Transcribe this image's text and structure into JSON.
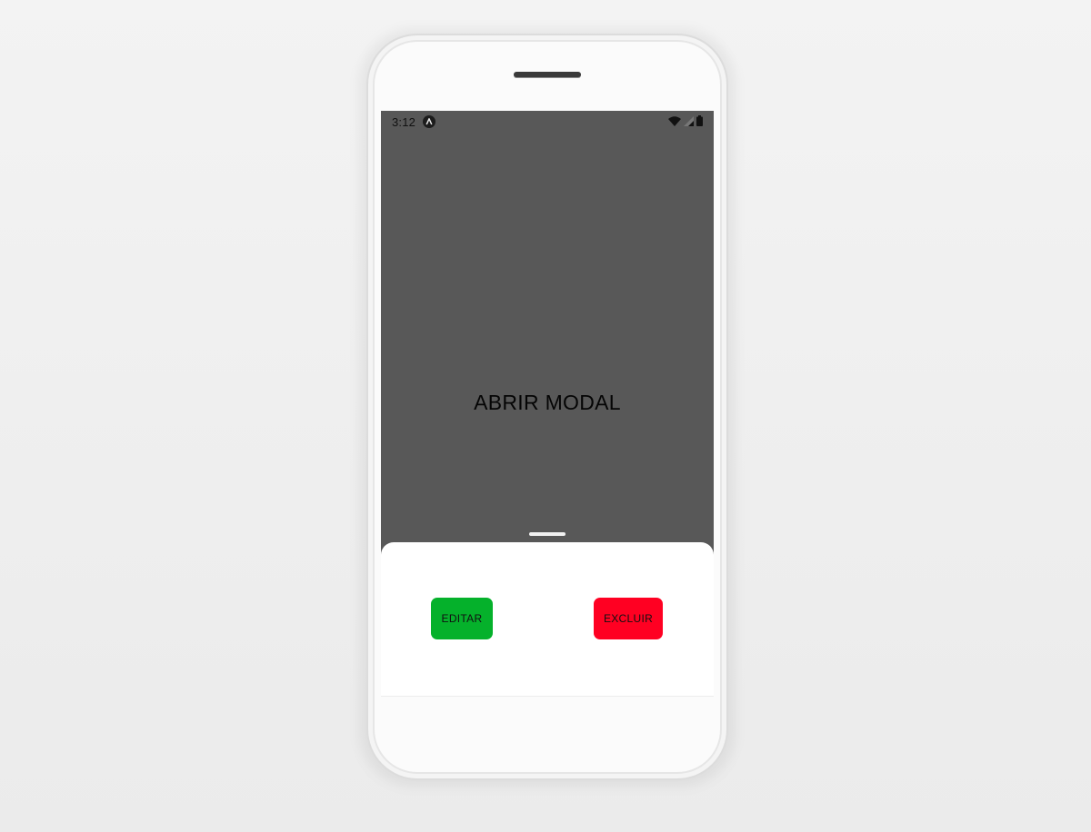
{
  "status_bar": {
    "time": "3:12",
    "app_icon": "letter-a-circle-icon",
    "icons": [
      "wifi-icon",
      "cell-signal-icon",
      "battery-icon"
    ]
  },
  "main": {
    "title": "ABRIR MODAL"
  },
  "modal": {
    "edit_label": "EDITAR",
    "delete_label": "EXCLUIR"
  },
  "colors": {
    "screen_background": "#585858",
    "sheet_background": "#ffffff",
    "edit_button": "#05b12b",
    "delete_button": "#ff0022"
  }
}
